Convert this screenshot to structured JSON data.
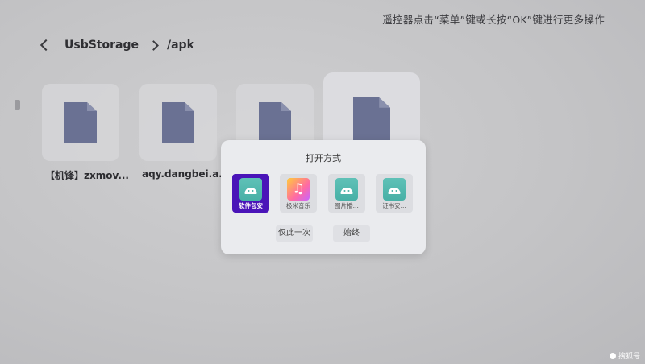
{
  "hint": "遥控器点击“菜单”键或长按“OK”键进行更多操作",
  "breadcrumb": {
    "root": "UsbStorage",
    "folder": "/apk"
  },
  "files": [
    {
      "label": "【机锋】zxmov..."
    },
    {
      "label": "aqy.dangbei.a..."
    }
  ],
  "dialog": {
    "title": "打开方式",
    "apps": [
      {
        "label": "软件包安",
        "icon": "android-icon",
        "selected": true
      },
      {
        "label": "极米音乐",
        "icon": "music-note-icon",
        "selected": false
      },
      {
        "label": "图片播...",
        "icon": "android-icon",
        "selected": false
      },
      {
        "label": "证书安...",
        "icon": "android-icon",
        "selected": false
      }
    ],
    "buttons": {
      "once": "仅此一次",
      "always": "始终"
    }
  },
  "watermark": "搜狐号",
  "colors": {
    "selected_app": "#4a14b8",
    "file_icon": "#6a7193",
    "android_green": "#48b0a6"
  }
}
